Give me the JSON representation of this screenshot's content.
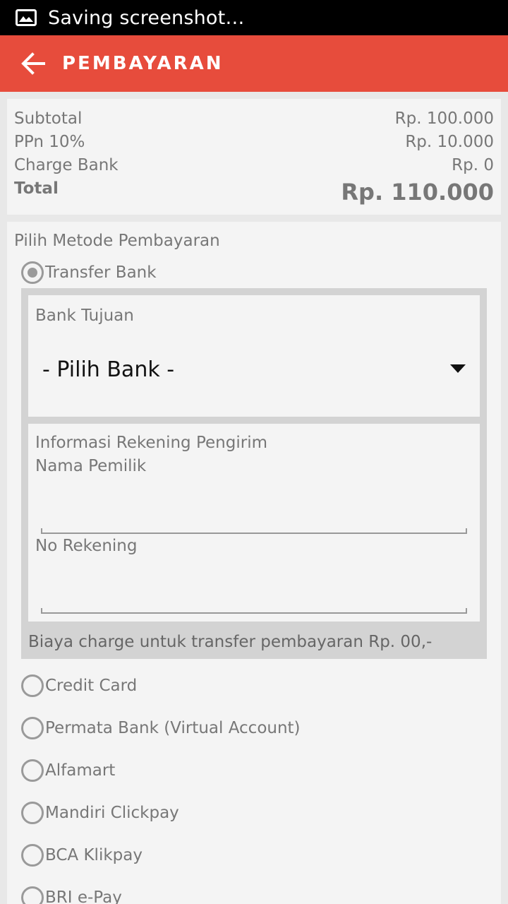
{
  "status_bar": {
    "text": "Saving screenshot…",
    "icon": "image-icon"
  },
  "app_bar": {
    "title": "PEMBAYARAN",
    "back_icon": "arrow-left-icon"
  },
  "summary": {
    "subtotal_label": "Subtotal",
    "subtotal_value": "Rp. 100.000",
    "ppn_label": "PPn 10%",
    "ppn_value": "Rp. 10.000",
    "charge_label": "Charge Bank",
    "charge_value": "Rp. 0",
    "total_label": "Total",
    "total_value": "Rp. 110.000"
  },
  "payment": {
    "heading": "Pilih Metode Pembayaran",
    "selected": "Transfer Bank",
    "methods": [
      {
        "label": "Transfer Bank",
        "checked": true
      },
      {
        "label": "Credit Card",
        "checked": false
      },
      {
        "label": "Permata Bank (Virtual Account)",
        "checked": false
      },
      {
        "label": "Alfamart",
        "checked": false
      },
      {
        "label": "Mandiri Clickpay",
        "checked": false
      },
      {
        "label": "BCA Klikpay",
        "checked": false
      },
      {
        "label": "BRI e-Pay",
        "checked": false
      }
    ],
    "transfer": {
      "bank_label": "Bank Tujuan",
      "bank_select_value": "- Pilih Bank -",
      "sender_heading": "Informasi Rekening Pengirim",
      "owner_label": "Nama Pemilik",
      "owner_value": "",
      "account_label": "No Rekening",
      "account_value": "",
      "charge_note": "Biaya charge untuk transfer pembayaran Rp. 00,-"
    }
  },
  "colors": {
    "accent": "#e74c3c",
    "status_bar": "#000000",
    "card": "#f4f4f4",
    "panel": "#d3d3d3"
  }
}
